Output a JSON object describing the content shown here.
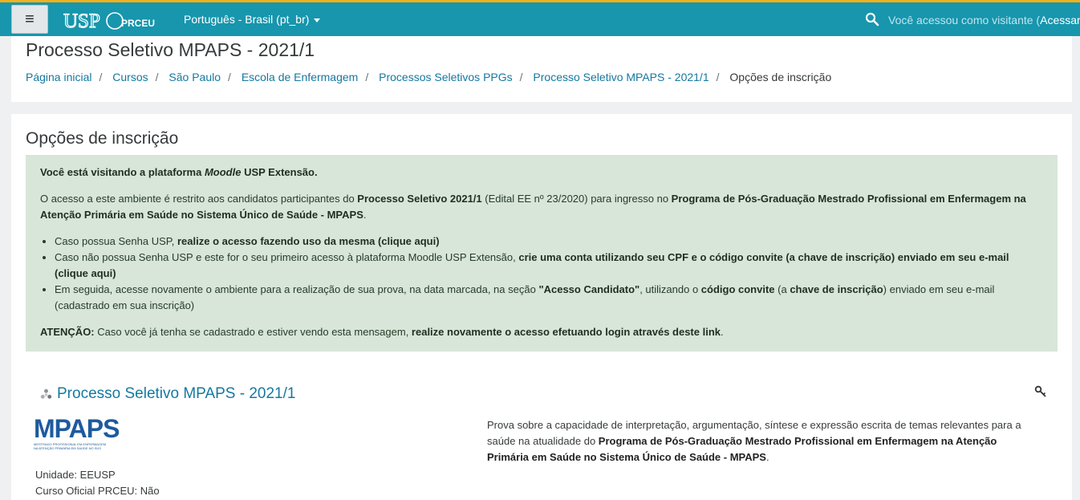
{
  "navbar": {
    "menu_icon": "hamburger-icon",
    "logo_usp": "USP",
    "logo_prceu": "PRCEU",
    "language": "Português - Brasil ‎(pt_br)‎",
    "search_icon": "search-icon",
    "visitor_text": "Você acessou como visitante (",
    "login_link": "Acessar",
    "visitor_close": ")"
  },
  "header": {
    "title": "Processo Seletivo MPAPS - 2021/1",
    "breadcrumb": [
      "Página inicial",
      "Cursos",
      "São Paulo",
      "Escola de Enfermagem",
      "Processos Seletivos PPGs",
      "Processo Seletivo MPAPS - 2021/1"
    ],
    "breadcrumb_current": "Opções de inscrição"
  },
  "main": {
    "section_title": "Opções de inscrição",
    "alert": {
      "p1_a": "Você está visitando a plataforma ",
      "p1_b": "Moodle",
      "p1_c": " USP Extensão.",
      "p2_a": "O acesso a este ambiente é restrito aos candidatos participantes do ",
      "p2_b": "Processo Seletivo 2021/1",
      "p2_c": " (Edital EE nº 23/2020) para ingresso no ",
      "p2_d": "Programa de Pós-Graduação Mestrado Profissional em Enfermagem na Atenção Primária em Saúde no Sistema Único de Saúde - MPAPS",
      "p2_e": ".",
      "li1_a": "Caso possua Senha USP, ",
      "li1_b": "realize o acesso fazendo uso da mesma (clique aqui)",
      "li2_a": "Caso não possua Senha USP e este for o seu primeiro acesso à plataforma Moodle USP Extensão, ",
      "li2_b": "crie uma conta utilizando seu CPF e o código convite (a chave de inscrição) enviado em seu e-mail (clique aqui)",
      "li3_a": "Em seguida, acesse novamente o ambiente para a realização de sua prova, na data marcada, na seção ",
      "li3_b": "\"Acesso Candidato\"",
      "li3_c": ", utilizando o ",
      "li3_d": "código convite",
      "li3_e": " (a ",
      "li3_f": "chave de inscrição",
      "li3_g": ") enviado em seu e-mail (cadastrado em sua inscrição)",
      "p3_a": "ATENÇÃO:",
      "p3_b": " Caso você já tenha se cadastrado e estiver vendo esta mensagem, ",
      "p3_c": "realize novamente o acesso efetuando login através deste link",
      "p3_d": "."
    },
    "course": {
      "name": "Processo Seletivo MPAPS - 2021/1",
      "course_icon": "course-icon",
      "key_icon": "key-icon",
      "logo_text": "MPAPS",
      "logo_sub1": "MESTRADO PROFISSIONAL EM ENFERMAGEM",
      "logo_sub2": "NA ATENÇÃO PRIMÁRIA EM SAÚDE NO SUS",
      "unit": "Unidade: EEUSP",
      "official": "Curso Oficial PRCEU: Não",
      "summary_a": "Prova sobre a capacidade de interpretação, argumentação, síntese e expressão escrita de temas relevantes para a saúde na atualidade do ",
      "summary_b": "Programa de Pós-Graduação Mestrado Profissional em Enfermagem na Atenção Primária em Saúde no Sistema Único de Saúde - MPAPS",
      "summary_c": "."
    }
  }
}
